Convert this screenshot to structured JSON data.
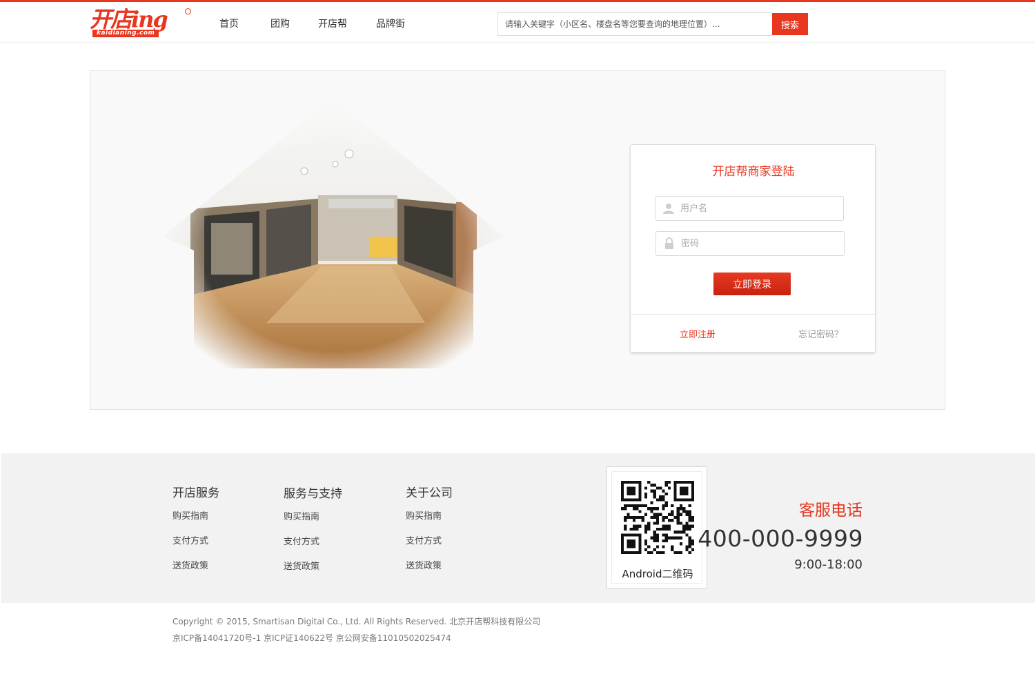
{
  "brand": {
    "logo_text": "开店ing",
    "logo_domain": "kaidianing.com",
    "logo_mark": "TM"
  },
  "nav": [
    {
      "label": "首页"
    },
    {
      "label": "团购"
    },
    {
      "label": "开店帮"
    },
    {
      "label": "品牌街"
    }
  ],
  "search": {
    "placeholder": "请输入关键字（小区名、楼盘名等您要查询的地理位置）...",
    "button_label": "搜索"
  },
  "login": {
    "title": "开店帮商家登陆",
    "username_placeholder": "用户名",
    "password_placeholder": "密码",
    "submit_label": "立即登录",
    "register_label": "立即注册",
    "forgot_label": "忘记密码？"
  },
  "footer": {
    "columns": [
      {
        "title": "开店服务",
        "links": [
          "购买指南",
          "支付方式",
          "送货政策"
        ]
      },
      {
        "title": "服务与支持",
        "links": [
          "购买指南",
          "支付方式",
          "送货政策"
        ]
      },
      {
        "title": "关于公司",
        "links": [
          "购买指南",
          "支付方式",
          "送货政策"
        ]
      }
    ],
    "qr_label": "Android二维码",
    "service_title": "客服电话",
    "service_phone": "400-000-9999",
    "service_hours": "9:00-18:00"
  },
  "copyright": {
    "line1": "Copyright © 2015, Smartisan Digital Co., Ltd. All Rights Reserved. 北京开店帮科技有限公司",
    "line2": "京ICP备14041720号-1 京ICP证140622号 京公网安备11010502025474"
  },
  "colors": {
    "accent": "#e8361f",
    "footer_bg": "#f2f2f2",
    "panel_bg": "#f9f9f9"
  }
}
